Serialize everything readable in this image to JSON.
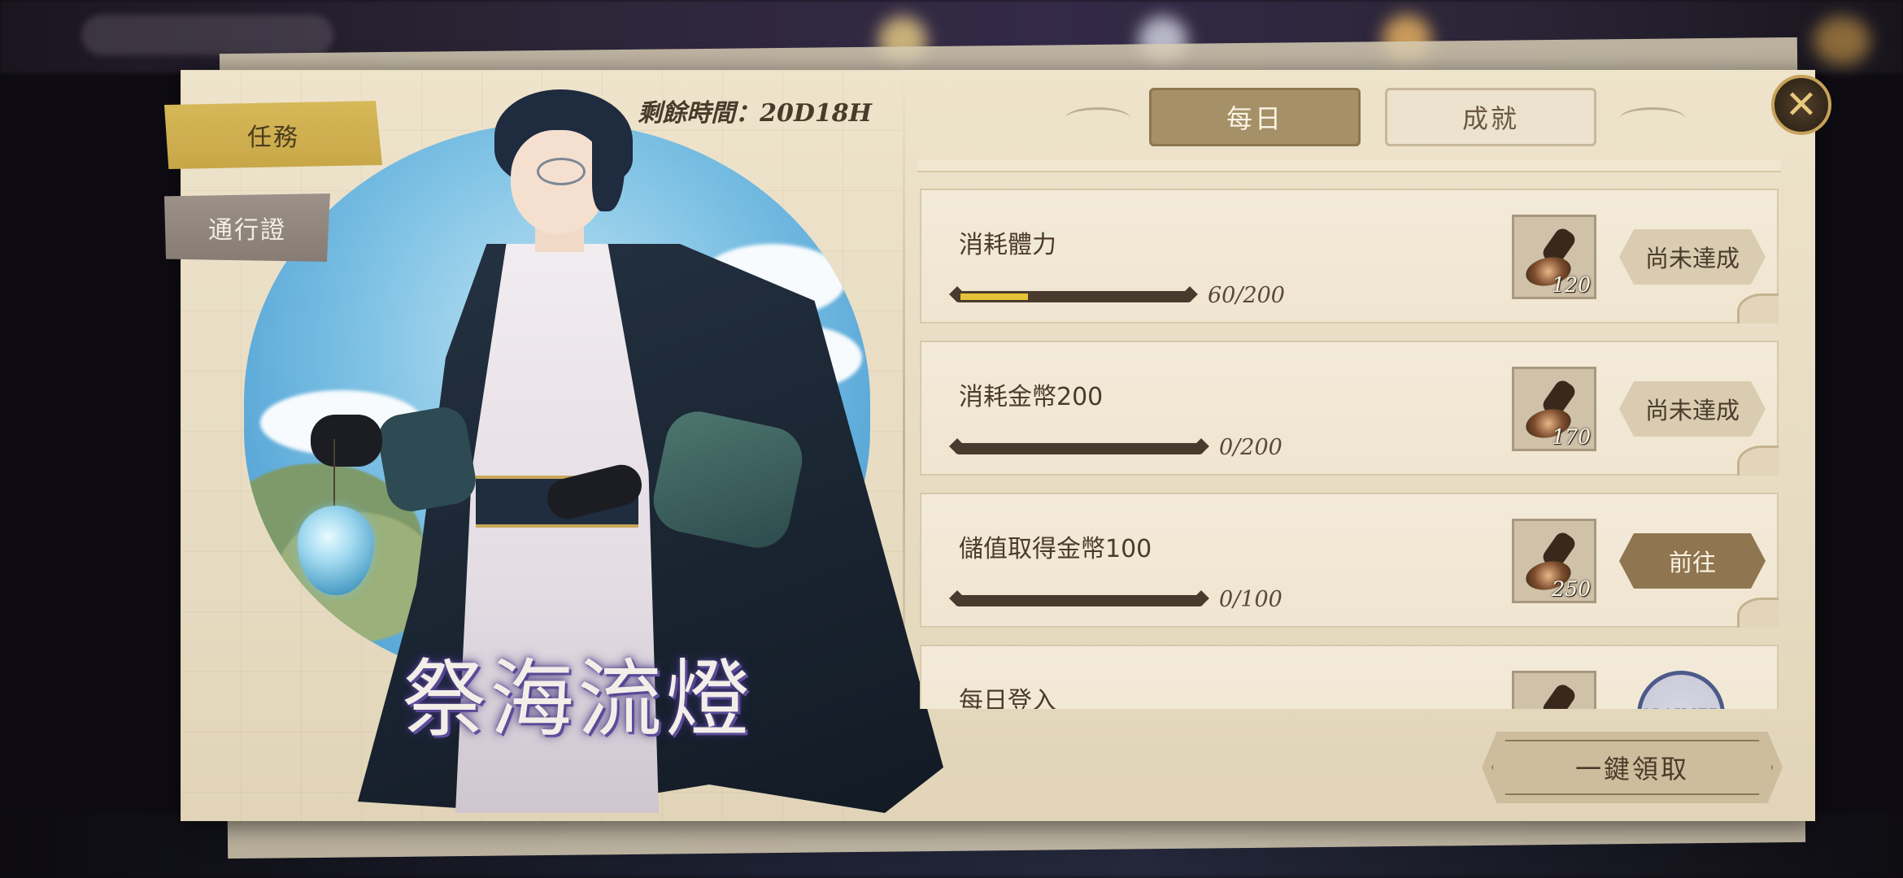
{
  "side_tabs": {
    "mission": "任務",
    "pass": "通行證"
  },
  "timer": "剩餘時間：20D18H",
  "event_logo": "祭海流燈",
  "top_tabs": {
    "daily": "每日",
    "achievement": "成就"
  },
  "close_icon": "✕",
  "missions": [
    {
      "title": "消耗體力",
      "progress": "60/200",
      "progress_fraction": 0.3,
      "reward_count": "120",
      "status": "尚未達成",
      "state": "pending"
    },
    {
      "title": "消耗金幣200",
      "progress": "0/200",
      "progress_fraction": 0.0,
      "reward_count": "170",
      "status": "尚未達成",
      "state": "pending"
    },
    {
      "title": "儲值取得金幣100",
      "progress": "0/100",
      "progress_fraction": 0.0,
      "reward_count": "250",
      "status": "前往",
      "state": "go"
    },
    {
      "title": "每日登入",
      "reward_count": "",
      "status": "CLAIMED",
      "state": "claimed"
    }
  ],
  "claim_all": "一鍵領取",
  "colors": {
    "progress_fill": "#e6c238",
    "active_side_tab": "#d7b95a",
    "active_top_tab": "#a59068"
  }
}
